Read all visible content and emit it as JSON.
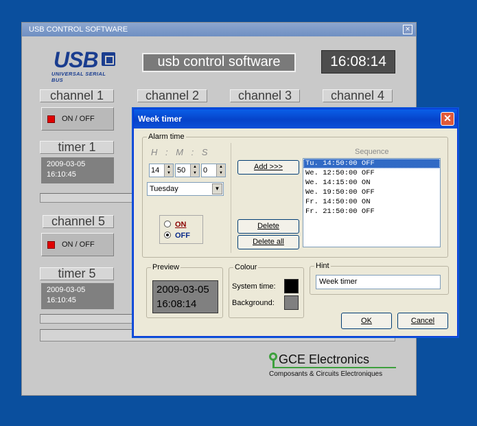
{
  "colors": {
    "desktop": "#0a4f9e",
    "dialog_title": "#0a5fe8",
    "led": "#e00000",
    "system_time_swatch": "#000000",
    "background_swatch": "#808080",
    "selection": "#316ac5"
  },
  "main": {
    "title": "USB CONTROL SOFTWARE",
    "close_glyph": "×",
    "logo": {
      "big": "USB",
      "sub": "UNIVERSAL SERIAL BUS"
    },
    "app_title": "usb control software",
    "clock": "16:08:14",
    "channels": [
      "channel 1",
      "channel 2",
      "channel 3",
      "channel 4"
    ],
    "channel1_toggle": "ON / OFF",
    "timer1": {
      "label": "timer 1",
      "date": "2009-03-05",
      "time": "16:10:45"
    },
    "channel5": "channel 5",
    "channel5_toggle": "ON / OFF",
    "timer5": {
      "label": "timer 5",
      "date": "2009-03-05",
      "time": "16:10:45"
    },
    "brand": {
      "name": "GCE Electronics",
      "sub": "Composants & Circuits Electroniques"
    }
  },
  "dialog": {
    "title": "Week timer",
    "close_glyph": "✕",
    "alarm": {
      "group_title": "Alarm time",
      "hms_label": "H : M : S",
      "hour": "14",
      "minute": "50",
      "second": "0",
      "day": "Tuesday",
      "on_label": "ON",
      "off_label": "OFF"
    },
    "buttons": {
      "add": "Add >>>",
      "delete": "Delete",
      "delete_all": "Delete all",
      "ok": "OK",
      "cancel": "Cancel"
    },
    "sequence": {
      "title": "Sequence",
      "items": [
        "Tu. 14:50:00 OFF",
        "We. 12:50:00 OFF",
        "We. 14:15:00 ON",
        "We. 19:50:00 OFF",
        "Fr. 14:50:00 ON",
        "Fr. 21:50:00 OFF"
      ]
    },
    "preview": {
      "group_title": "Preview",
      "date": "2009-03-05",
      "time": "16:08:14"
    },
    "colour": {
      "group_title": "Colour",
      "system_time": "System time:",
      "background": "Background:"
    },
    "hint": {
      "group_title": "Hint",
      "value": "Week timer"
    }
  }
}
